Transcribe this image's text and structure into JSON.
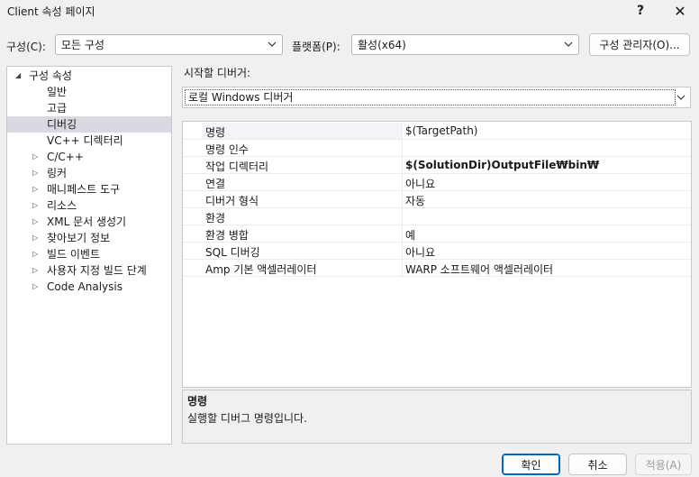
{
  "window": {
    "title": "Client 속성 페이지",
    "help_label": "?",
    "close_label": "✕"
  },
  "config": {
    "config_label": "구성(C):",
    "config_value": "모든 구성",
    "platform_label": "플랫폼(P):",
    "platform_value": "활성(x64)",
    "manager_button": "구성 관리자(O)..."
  },
  "tree": {
    "root_label": "구성 속성",
    "root_expander": "◢",
    "child_expander": "▷",
    "items": [
      {
        "label": "일반"
      },
      {
        "label": "고급"
      },
      {
        "label": "디버깅",
        "selected": true
      },
      {
        "label": "VC++ 디렉터리"
      },
      {
        "label": "C/C++",
        "expandable": true
      },
      {
        "label": "링커",
        "expandable": true
      },
      {
        "label": "매니페스트 도구",
        "expandable": true
      },
      {
        "label": "리소스",
        "expandable": true
      },
      {
        "label": "XML 문서 생성기",
        "expandable": true
      },
      {
        "label": "찾아보기 정보",
        "expandable": true
      },
      {
        "label": "빌드 이벤트",
        "expandable": true
      },
      {
        "label": "사용자 지정 빌드 단계",
        "expandable": true
      },
      {
        "label": "Code Analysis",
        "expandable": true
      }
    ]
  },
  "debugger": {
    "label": "시작할 디버거:",
    "value": "로컬 Windows 디버거"
  },
  "properties": [
    {
      "name": "명령",
      "value": "$(TargetPath)",
      "bold": false
    },
    {
      "name": "명령 인수",
      "value": "",
      "bold": false
    },
    {
      "name": "작업 디렉터리",
      "value": "$(SolutionDir)OutputFile₩bin₩",
      "bold": true
    },
    {
      "name": "연결",
      "value": "아니요",
      "bold": false
    },
    {
      "name": "디버거 형식",
      "value": "자동",
      "bold": false
    },
    {
      "name": "환경",
      "value": "",
      "bold": false
    },
    {
      "name": "환경 병합",
      "value": "예",
      "bold": false
    },
    {
      "name": "SQL 디버깅",
      "value": "아니요",
      "bold": false
    },
    {
      "name": "Amp 기본 액셀러레이터",
      "value": "WARP 소프트웨어 액셀러레이터",
      "bold": false
    }
  ],
  "description": {
    "title": "명령",
    "text": "실행할 디버그 명령입니다."
  },
  "buttons": {
    "ok": "확인",
    "cancel": "취소",
    "apply": "적용(A)"
  },
  "icons": {
    "chevron": "chevron-down-icon",
    "expander": "triangle-right-icon"
  }
}
